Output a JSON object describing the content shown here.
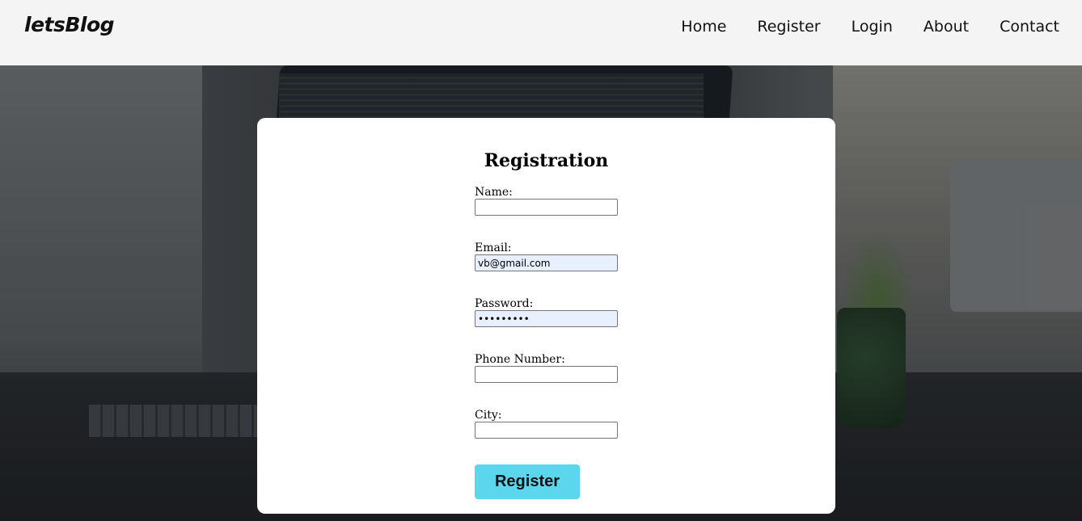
{
  "header": {
    "brand": "letsBlog",
    "nav": [
      {
        "label": "Home"
      },
      {
        "label": "Register"
      },
      {
        "label": "Login"
      },
      {
        "label": "About"
      },
      {
        "label": "Contact"
      }
    ]
  },
  "form": {
    "title": "Registration",
    "fields": [
      {
        "label": "Name:",
        "value": "",
        "type": "text"
      },
      {
        "label": "Email:",
        "value": "vb@gmail.com",
        "type": "email"
      },
      {
        "label": "Password:",
        "value": "•••••••••",
        "type": "password"
      },
      {
        "label": "Phone Number:",
        "value": "",
        "type": "tel"
      },
      {
        "label": "City:",
        "value": "",
        "type": "text"
      }
    ],
    "submit_label": "Register"
  },
  "colors": {
    "header_bg": "#f4f4f4",
    "card_bg": "#ffffff",
    "button_bg": "#5bd6ed",
    "autofill_bg": "#e8f0fe"
  }
}
